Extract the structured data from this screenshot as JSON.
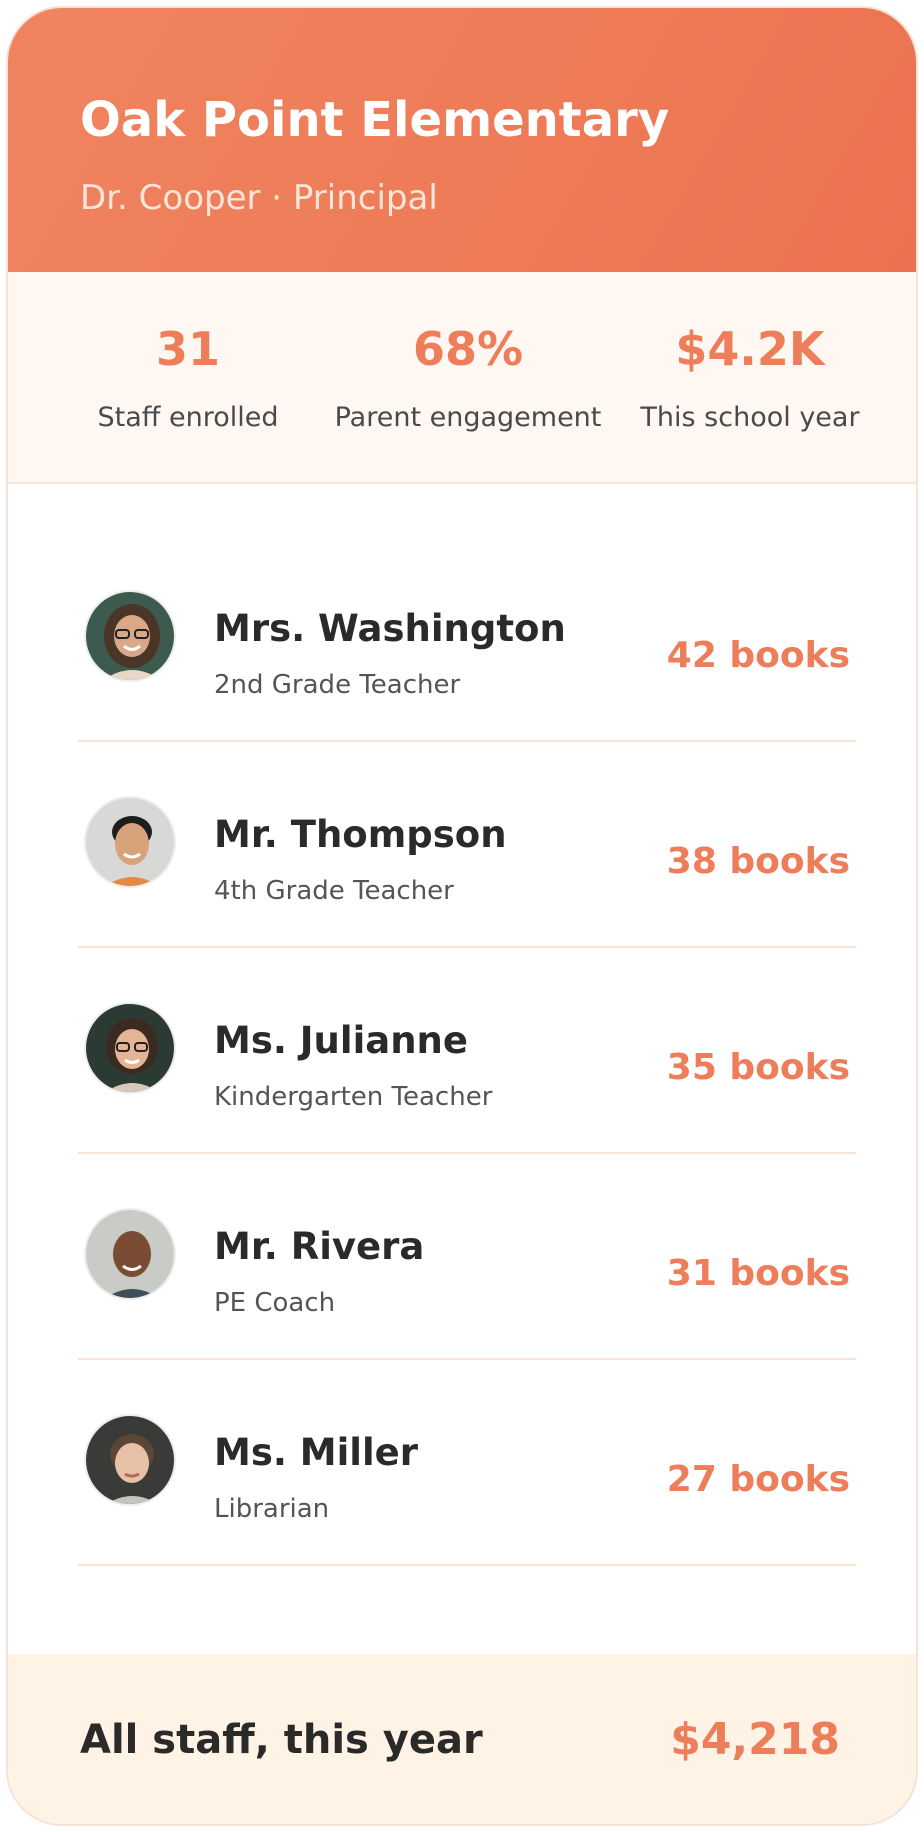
{
  "school": {
    "name": "Oak Point Elementary",
    "principal": "Dr. Cooper · Principal"
  },
  "stats": [
    {
      "value": "31",
      "label": "Staff enrolled"
    },
    {
      "value": "68%",
      "label": "Parent engagement"
    },
    {
      "value": "$4.2K",
      "label": "This school year"
    }
  ],
  "staff": [
    {
      "name": "Mrs. Washington",
      "role": "2nd Grade Teacher",
      "books": "42 books"
    },
    {
      "name": "Mr. Thompson",
      "role": "4th Grade Teacher",
      "books": "38 books"
    },
    {
      "name": "Ms. Julianne",
      "role": "Kindergarten Teacher",
      "books": "35 books"
    },
    {
      "name": "Mr. Rivera",
      "role": "PE Coach",
      "books": "31 books"
    },
    {
      "name": "Ms. Miller",
      "role": "Librarian",
      "books": "27 books"
    }
  ],
  "footer": {
    "label": "All staff, this year",
    "total": "$4,218"
  },
  "colors": {
    "accent": "#ee7d5a",
    "header": "#ee7a56",
    "stats_bg": "#fff7f2",
    "footer_bg": "#fff3e6"
  }
}
